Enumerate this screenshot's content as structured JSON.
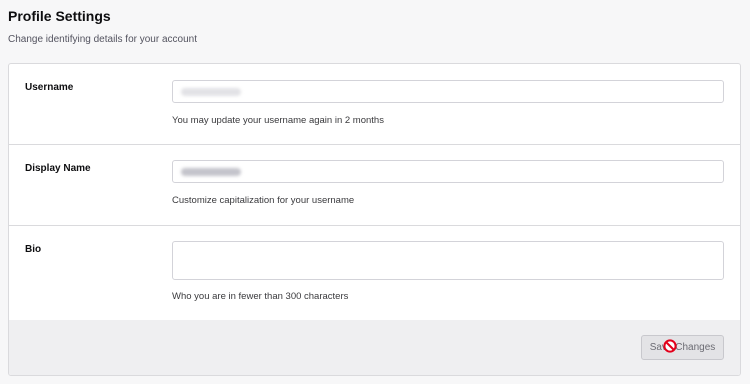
{
  "header": {
    "title": "Profile Settings",
    "subtitle": "Change identifying details for your account"
  },
  "form": {
    "username": {
      "label": "Username",
      "hint": "You may update your username again in 2 months"
    },
    "display_name": {
      "label": "Display Name",
      "hint": "Customize capitalization for your username"
    },
    "bio": {
      "label": "Bio",
      "value": "",
      "hint": "Who you are in fewer than 300 characters"
    }
  },
  "footer": {
    "save_label": "Save Changes",
    "save_disabled": true
  },
  "cursor": {
    "icon": "not-allowed-icon",
    "color": "#e3001b"
  }
}
